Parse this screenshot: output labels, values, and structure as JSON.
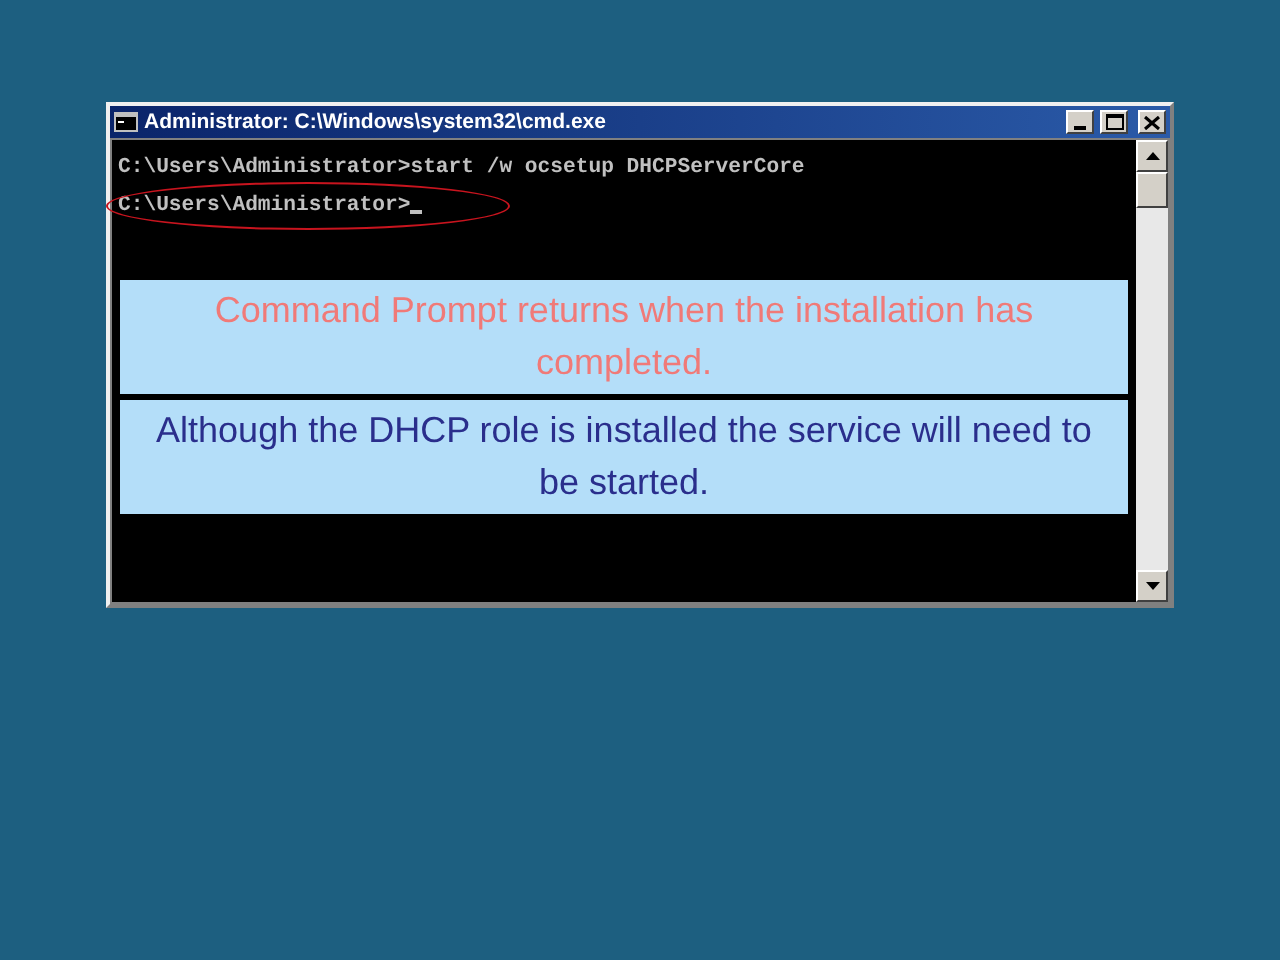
{
  "window": {
    "title": "Administrator: C:\\Windows\\system32\\cmd.exe"
  },
  "console": {
    "lines": [
      {
        "text": "C:\\Users\\Administrator>start /w ocsetup DHCPServerCore",
        "cursor": false,
        "circled": false
      },
      {
        "text": "C:\\Users\\Administrator>",
        "cursor": true,
        "circled": true
      }
    ]
  },
  "callouts": [
    {
      "text": "Command Prompt returns when the installation has completed.",
      "color": "#f07a78"
    },
    {
      "text": "Although the DHCP role is installed the service will need to be started.",
      "color": "#2a2e8c"
    }
  ]
}
